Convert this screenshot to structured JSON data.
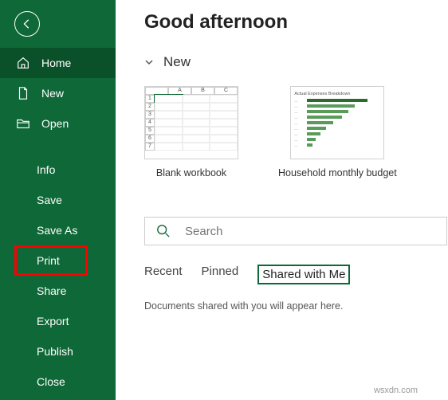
{
  "title": "Good afternoon",
  "sidebar": {
    "home": "Home",
    "new": "New",
    "open": "Open",
    "info": "Info",
    "save": "Save",
    "saveAs": "Save As",
    "print": "Print",
    "share": "Share",
    "export": "Export",
    "publish": "Publish",
    "close": "Close"
  },
  "section": {
    "new": "New"
  },
  "templates": {
    "blank": "Blank workbook",
    "budget": "Household monthly budget",
    "budgetChartTitle": "Actual Expenses Breakdown"
  },
  "search": {
    "placeholder": "Search"
  },
  "tabs": {
    "recent": "Recent",
    "pinned": "Pinned",
    "shared": "Shared with Me"
  },
  "emptyMessage": "Documents shared with you will appear here.",
  "watermark": "wsxdn.com"
}
